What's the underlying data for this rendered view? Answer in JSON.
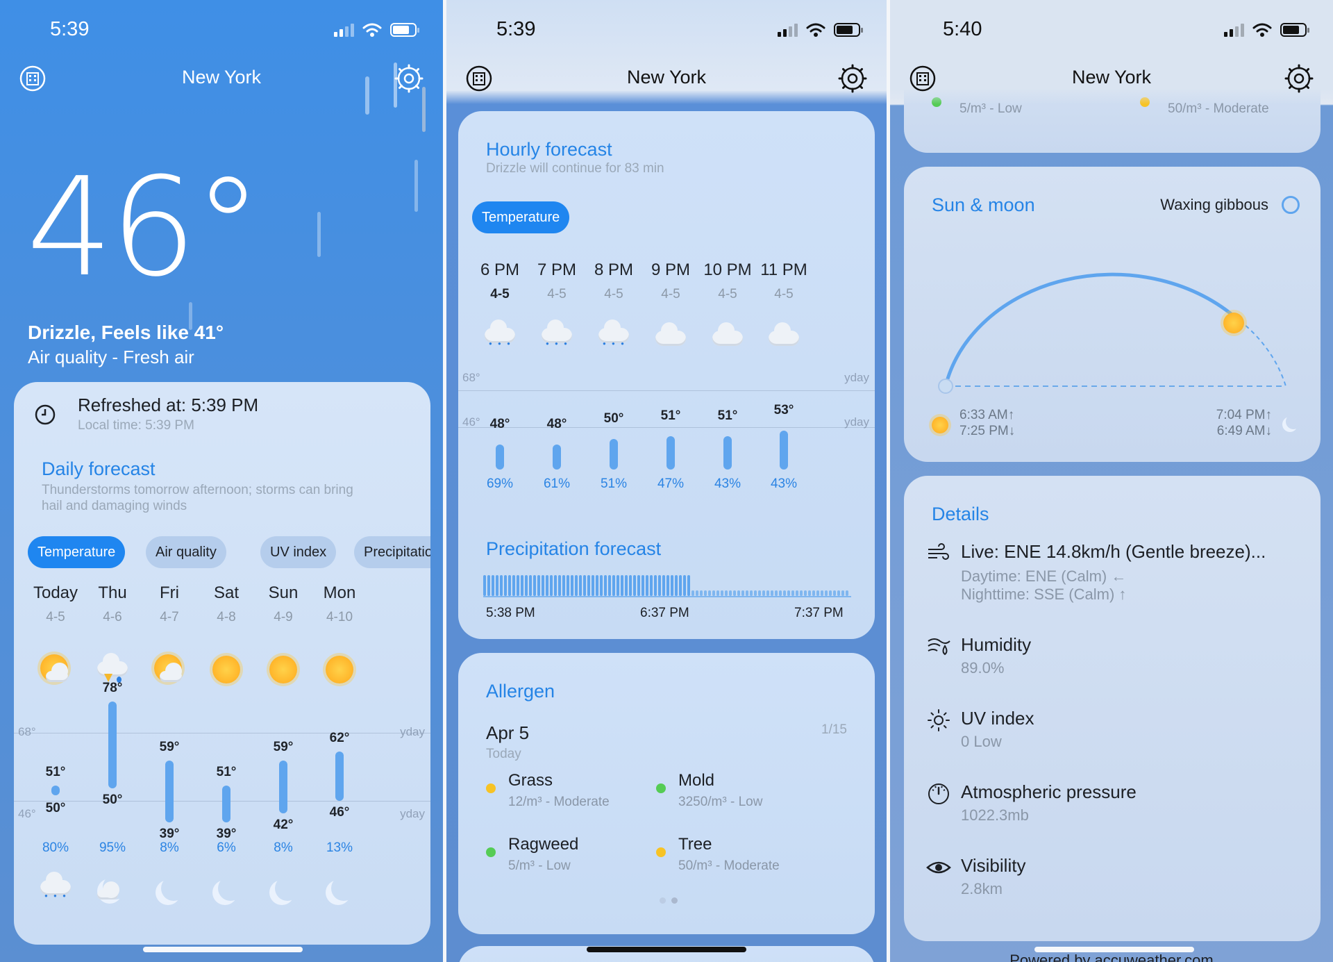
{
  "screens": [
    {
      "time": "5:39",
      "city": "New York",
      "current": {
        "temp": "46°",
        "condition": "Drizzle, Feels like 41°",
        "air_quality": "Air quality - Fresh air"
      },
      "refresh": {
        "title": "Refreshed at: 5:39 PM",
        "local": "Local time: 5:39 PM"
      },
      "daily": {
        "title": "Daily forecast",
        "desc_line1": "Thunderstorms tomorrow afternoon; storms can bring",
        "desc_line2": "hail and damaging winds",
        "tabs": [
          "Temperature",
          "Air quality",
          "UV index",
          "Precipitation"
        ],
        "ref_high": "68°",
        "ref_low": "46°",
        "yday_high": "yday",
        "yday_low": "yday",
        "days": [
          {
            "day": "Today",
            "date": "4-5",
            "high": "51°",
            "low": "50°",
            "precip": "80%",
            "icon": "partly-sunny-icon",
            "night_icon": "rain-cloud-icon"
          },
          {
            "day": "Thu",
            "date": "4-6",
            "high": "78°",
            "low": "50°",
            "precip": "95%",
            "icon": "thunderstorm-icon",
            "night_icon": "cloudy-moon-icon"
          },
          {
            "day": "Fri",
            "date": "4-7",
            "high": "59°",
            "low": "39°",
            "precip": "8%",
            "icon": "partly-sunny-icon",
            "night_icon": "moon-icon"
          },
          {
            "day": "Sat",
            "date": "4-8",
            "high": "51°",
            "low": "39°",
            "precip": "6%",
            "icon": "sun-icon",
            "night_icon": "moon-icon"
          },
          {
            "day": "Sun",
            "date": "4-9",
            "high": "59°",
            "low": "42°",
            "precip": "8%",
            "icon": "sun-icon",
            "night_icon": "moon-icon"
          },
          {
            "day": "Mon",
            "date": "4-10",
            "high": "62°",
            "low": "46°",
            "precip": "13%",
            "icon": "sun-icon",
            "night_icon": "moon-icon"
          }
        ]
      }
    },
    {
      "time": "5:39",
      "city": "New York",
      "hourly": {
        "title": "Hourly forecast",
        "subtitle": "Drizzle will continue for 83 min",
        "tab": "Temperature",
        "ref_high": "68°",
        "ref_low": "46°",
        "yday_high": "yday",
        "yday_low": "yday",
        "hours": [
          {
            "hour": "6 PM",
            "date": "4-5",
            "temp": "48°",
            "precip": "69%",
            "icon": "rain-cloud-icon"
          },
          {
            "hour": "7 PM",
            "date": "4-5",
            "temp": "48°",
            "precip": "61%",
            "icon": "rain-cloud-icon"
          },
          {
            "hour": "8 PM",
            "date": "4-5",
            "temp": "50°",
            "precip": "51%",
            "icon": "rain-cloud-icon"
          },
          {
            "hour": "9 PM",
            "date": "4-5",
            "temp": "51°",
            "precip": "47%",
            "icon": "cloud-icon"
          },
          {
            "hour": "10 PM",
            "date": "4-5",
            "temp": "51°",
            "precip": "43%",
            "icon": "cloud-icon"
          },
          {
            "hour": "11 PM",
            "date": "4-5",
            "temp": "53°",
            "precip": "43%",
            "icon": "cloud-icon"
          }
        ]
      },
      "precipitation": {
        "title": "Precipitation forecast",
        "times": [
          "5:38 PM",
          "6:37 PM",
          "7:37 PM"
        ]
      },
      "allergen": {
        "title": "Allergen",
        "date": "Apr 5",
        "day": "Today",
        "page": "1/15",
        "items": [
          {
            "name": "Grass",
            "value": "12/m³ - Moderate",
            "color": "#f7c325"
          },
          {
            "name": "Mold",
            "value": "3250/m³ - Low",
            "color": "#55cc55"
          },
          {
            "name": "Ragweed",
            "value": "5/m³ - Low",
            "color": "#55cc55"
          },
          {
            "name": "Tree",
            "value": "50/m³ - Moderate",
            "color": "#f7c325"
          }
        ]
      }
    },
    {
      "time": "5:40",
      "city": "New York",
      "top_clip": {
        "left": "5/m³ - Low",
        "right": "50/m³ - Moderate"
      },
      "sun_moon": {
        "title": "Sun & moon",
        "phase": "Waxing gibbous",
        "sunrise": "6:33 AM↑",
        "sunset": "7:25 PM↓",
        "moonrise": "7:04 PM↑",
        "moonset": "6:49 AM↓"
      },
      "details": {
        "title": "Details",
        "wind": {
          "title": "Live: ENE 14.8km/h (Gentle breeze)...",
          "day": "Daytime: ENE (Calm) ←",
          "night": "Nighttime: SSE (Calm) ↑"
        },
        "humidity": {
          "title": "Humidity",
          "value": "89.0%"
        },
        "uv": {
          "title": "UV index",
          "value": "0 Low"
        },
        "pressure": {
          "title": "Atmospheric pressure",
          "value": "1022.3mb"
        },
        "visibility": {
          "title": "Visibility",
          "value": "2.8km"
        }
      },
      "footer_clip": "Powered by accuweather.com"
    }
  ],
  "colors": {
    "accent": "#1f86f0",
    "title_blue": "#2584e6",
    "moderate": "#f7c325",
    "low": "#55cc55"
  }
}
